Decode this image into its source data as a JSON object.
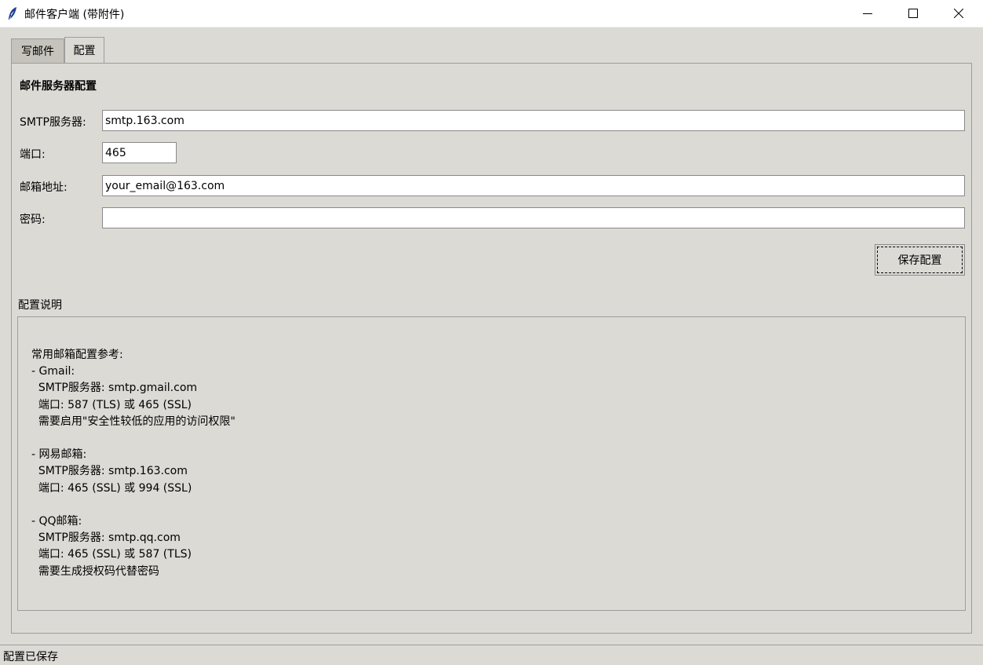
{
  "window": {
    "title": "邮件客户端 (带附件)",
    "icon": "feather-icon"
  },
  "tabs": [
    {
      "label": "写邮件",
      "selected": false
    },
    {
      "label": "配置",
      "selected": true
    }
  ],
  "config": {
    "section_title": "邮件服务器配置",
    "smtp_label": "SMTP服务器:",
    "smtp_value": "smtp.163.com",
    "port_label": "端口:",
    "port_value": "465",
    "email_label": "邮箱地址:",
    "email_value": "your_email@163.com",
    "password_label": "密码:",
    "password_value": "",
    "save_label": "保存配置"
  },
  "help": {
    "group_label": "配置说明",
    "text": "常用邮箱配置参考:\n- Gmail:\n  SMTP服务器: smtp.gmail.com\n  端口: 587 (TLS) 或 465 (SSL)\n  需要启用\"安全性较低的应用的访问权限\"\n\n- 网易邮箱:\n  SMTP服务器: smtp.163.com\n  端口: 465 (SSL) 或 994 (SSL)\n\n- QQ邮箱:\n  SMTP服务器: smtp.qq.com\n  端口: 465 (SSL) 或 587 (TLS)\n  需要生成授权码代替密码"
  },
  "status": {
    "text": "配置已保存"
  }
}
